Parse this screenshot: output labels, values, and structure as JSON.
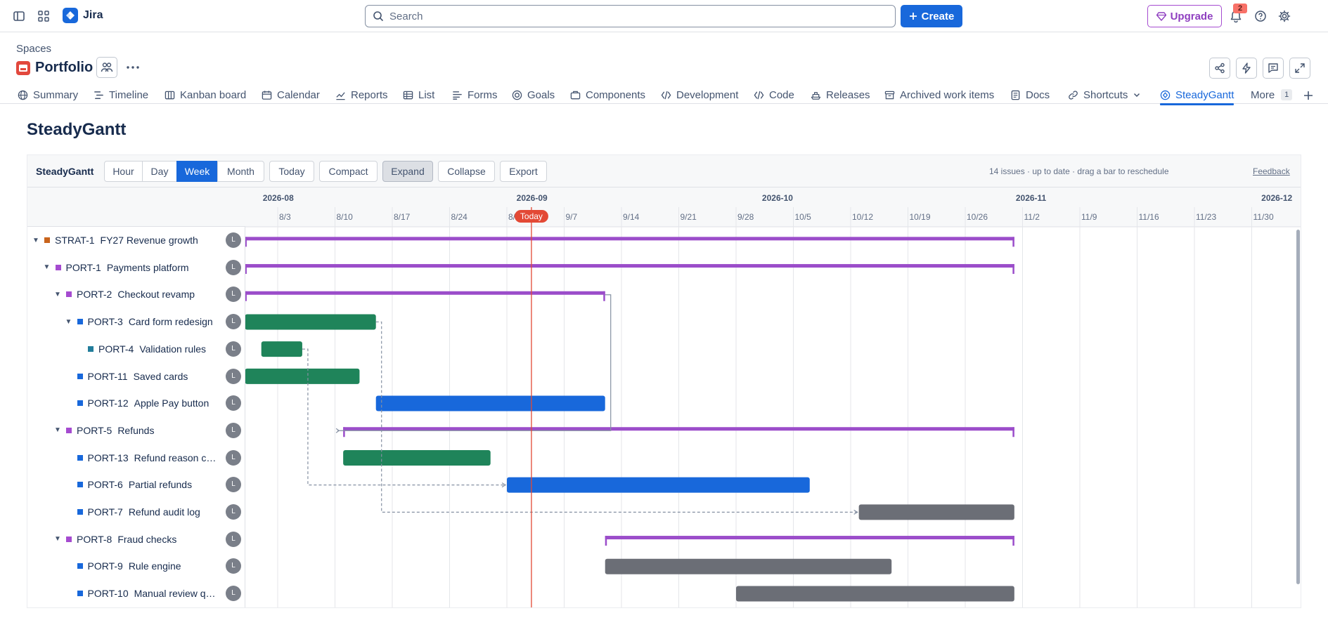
{
  "app": {
    "name": "Jira"
  },
  "topbar": {
    "search_placeholder": "Search",
    "create_label": "Create",
    "upgrade_label": "Upgrade",
    "notifications_count": "2"
  },
  "project": {
    "breadcrumb": "Spaces",
    "title": "Portfolio"
  },
  "tabs": [
    {
      "label": "Summary",
      "icon": "globe-icon"
    },
    {
      "label": "Timeline",
      "icon": "timeline-icon"
    },
    {
      "label": "Kanban board",
      "icon": "board-icon"
    },
    {
      "label": "Calendar",
      "icon": "calendar-icon"
    },
    {
      "label": "Reports",
      "icon": "chart-line-icon"
    },
    {
      "label": "List",
      "icon": "list-icon"
    },
    {
      "label": "Forms",
      "icon": "forms-icon"
    },
    {
      "label": "Goals",
      "icon": "target-icon"
    },
    {
      "label": "Components",
      "icon": "components-icon"
    },
    {
      "label": "Development",
      "icon": "branch-icon"
    },
    {
      "label": "Code",
      "icon": "code-icon"
    },
    {
      "label": "Releases",
      "icon": "ship-icon"
    },
    {
      "label": "Archived work items",
      "icon": "archive-icon"
    },
    {
      "label": "Docs",
      "icon": "doc-icon"
    },
    {
      "label": "Shortcuts",
      "icon": "link-icon"
    },
    {
      "label": "SteadyGantt",
      "icon": "gantt-app-icon",
      "active": true
    },
    {
      "label": "More",
      "icon": "",
      "count": "1"
    }
  ],
  "page": {
    "title": "SteadyGantt"
  },
  "gantt": {
    "brand": "SteadyGantt",
    "scale_buttons": [
      "Hour",
      "Day",
      "Week",
      "Month"
    ],
    "active_scale": "Week",
    "action_buttons": [
      "Today",
      "Compact",
      "Expand",
      "Collapse",
      "Export"
    ],
    "pressed_action": "Expand",
    "status_text": "14 issues · up to date · drag a bar to reschedule",
    "feedback_label": "Feedback",
    "today_label": "Today",
    "today_date": "2026-09-03",
    "months": [
      {
        "label": "2026-08",
        "date": "2026-08-01"
      },
      {
        "label": "2026-09",
        "date": "2026-09-01"
      },
      {
        "label": "2026-10",
        "date": "2026-10-01"
      },
      {
        "label": "2026-11",
        "date": "2026-11-01"
      },
      {
        "label": "2026-12",
        "date": "2026-12-01"
      }
    ],
    "weeks": [
      {
        "label": "8/3",
        "date": "2026-08-03"
      },
      {
        "label": "8/10",
        "date": "2026-08-10"
      },
      {
        "label": "8/17",
        "date": "2026-08-17"
      },
      {
        "label": "8/24",
        "date": "2026-08-24"
      },
      {
        "label": "8/31",
        "date": "2026-08-31"
      },
      {
        "label": "9/7",
        "date": "2026-09-07"
      },
      {
        "label": "9/14",
        "date": "2026-09-14"
      },
      {
        "label": "9/21",
        "date": "2026-09-21"
      },
      {
        "label": "9/28",
        "date": "2026-09-28"
      },
      {
        "label": "10/5",
        "date": "2026-10-05"
      },
      {
        "label": "10/12",
        "date": "2026-10-12"
      },
      {
        "label": "10/19",
        "date": "2026-10-19"
      },
      {
        "label": "10/26",
        "date": "2026-10-26"
      },
      {
        "label": "11/2",
        "date": "2026-11-02"
      },
      {
        "label": "11/9",
        "date": "2026-11-09"
      },
      {
        "label": "11/16",
        "date": "2026-11-16"
      },
      {
        "label": "11/23",
        "date": "2026-11-23"
      },
      {
        "label": "11/30",
        "date": "2026-11-30"
      }
    ],
    "colors": {
      "summary": "#9b4dca",
      "done": "#1f845a",
      "in_progress": "#1868db",
      "todo": "#6b6e76",
      "today_line": "#e34935",
      "strat_square": "#c9641c",
      "port_square": "#a54bd0",
      "task_square": "#1868db",
      "subtask_square": "#227d9b"
    },
    "rows": [
      {
        "key": "STRAT-1",
        "title": "FY27 Revenue growth",
        "level": 0,
        "expanded": true,
        "square": "strat",
        "avatar": "L",
        "bar": {
          "kind": "summary",
          "start": "2026-07-30",
          "end": "2026-11-01"
        }
      },
      {
        "key": "PORT-1",
        "title": "Payments platform",
        "level": 1,
        "expanded": true,
        "square": "port",
        "avatar": "L",
        "bar": {
          "kind": "summary",
          "start": "2026-07-30",
          "end": "2026-11-01"
        }
      },
      {
        "key": "PORT-2",
        "title": "Checkout revamp",
        "level": 2,
        "expanded": true,
        "square": "port",
        "avatar": "L",
        "bar": {
          "kind": "summary",
          "start": "2026-07-30",
          "end": "2026-09-12"
        }
      },
      {
        "key": "PORT-3",
        "title": "Card form redesign",
        "level": 3,
        "expanded": true,
        "square": "task",
        "avatar": "L",
        "bar": {
          "kind": "done",
          "start": "2026-07-30",
          "end": "2026-08-15"
        }
      },
      {
        "key": "PORT-4",
        "title": "Validation rules",
        "level": 4,
        "square": "subtask",
        "avatar": "L",
        "bar": {
          "kind": "done",
          "start": "2026-08-01",
          "end": "2026-08-06"
        }
      },
      {
        "key": "PORT-11",
        "title": "Saved cards",
        "level": 3,
        "square": "task",
        "avatar": "L",
        "bar": {
          "kind": "done",
          "start": "2026-07-30",
          "end": "2026-08-13"
        }
      },
      {
        "key": "PORT-12",
        "title": "Apple Pay button",
        "level": 3,
        "square": "task",
        "avatar": "L",
        "bar": {
          "kind": "in_progress",
          "start": "2026-08-15",
          "end": "2026-09-12"
        }
      },
      {
        "key": "PORT-5",
        "title": "Refunds",
        "level": 2,
        "expanded": true,
        "square": "port",
        "avatar": "L",
        "bar": {
          "kind": "summary",
          "start": "2026-08-11",
          "end": "2026-11-01"
        }
      },
      {
        "key": "PORT-13",
        "title": "Refund reason codes",
        "level": 3,
        "square": "task",
        "avatar": "L",
        "bar": {
          "kind": "done",
          "start": "2026-08-11",
          "end": "2026-08-29"
        }
      },
      {
        "key": "PORT-6",
        "title": "Partial refunds",
        "level": 3,
        "square": "task",
        "avatar": "L",
        "bar": {
          "kind": "in_progress",
          "start": "2026-08-31",
          "end": "2026-10-07"
        }
      },
      {
        "key": "PORT-7",
        "title": "Refund audit log",
        "level": 3,
        "square": "task",
        "avatar": "L",
        "bar": {
          "kind": "todo",
          "start": "2026-10-13",
          "end": "2026-11-01"
        }
      },
      {
        "key": "PORT-8",
        "title": "Fraud checks",
        "level": 2,
        "expanded": true,
        "square": "port",
        "avatar": "L",
        "bar": {
          "kind": "summary",
          "start": "2026-09-12",
          "end": "2026-11-01"
        }
      },
      {
        "key": "PORT-9",
        "title": "Rule engine",
        "level": 3,
        "square": "task",
        "avatar": "L",
        "bar": {
          "kind": "todo",
          "start": "2026-09-12",
          "end": "2026-10-17"
        }
      },
      {
        "key": "PORT-10",
        "title": "Manual review queue",
        "level": 3,
        "square": "task",
        "avatar": "L",
        "bar": {
          "kind": "todo",
          "start": "2026-09-28",
          "end": "2026-11-01"
        }
      }
    ],
    "dependencies": [
      {
        "from": "PORT-4",
        "to": "PORT-6"
      },
      {
        "from": "PORT-3",
        "to": "PORT-7"
      },
      {
        "from": "PORT-2",
        "to": "PORT-5"
      }
    ]
  }
}
